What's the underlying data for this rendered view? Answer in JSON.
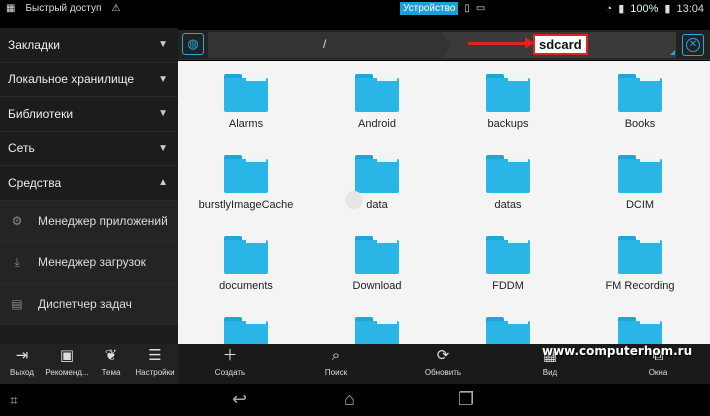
{
  "status_bar": {
    "left_label": "Быстрый доступ",
    "device_label": "Устройство",
    "battery": "100%",
    "time": "13:04"
  },
  "sidebar": {
    "sections": [
      {
        "label": "Закладки",
        "chevron": "chevron-down"
      },
      {
        "label": "Локальное хранилище",
        "chevron": "chevron-down"
      },
      {
        "label": "Библиотеки",
        "chevron": "chevron-down"
      },
      {
        "label": "Сеть",
        "chevron": "chevron-down"
      },
      {
        "label": "Средства",
        "chevron": "chevron-up"
      }
    ],
    "tools": [
      {
        "label": "Менеджер приложений",
        "icon": "gears-icon"
      },
      {
        "label": "Менеджер загрузок",
        "icon": "download-icon"
      },
      {
        "label": "Диспетчер задач",
        "icon": "task-manager-icon"
      }
    ]
  },
  "path_bar": {
    "root": "/",
    "current": "sdcard"
  },
  "folders": [
    {
      "name": "Alarms"
    },
    {
      "name": "Android"
    },
    {
      "name": "backups"
    },
    {
      "name": "Books"
    },
    {
      "name": "burstlyImageCache"
    },
    {
      "name": "data"
    },
    {
      "name": "datas"
    },
    {
      "name": "DCIM"
    },
    {
      "name": "documents"
    },
    {
      "name": "Download"
    },
    {
      "name": "FDDM"
    },
    {
      "name": "FM Recording"
    }
  ],
  "toolbar": {
    "left": [
      {
        "label": "Выход",
        "icon": "exit-icon"
      },
      {
        "label": "Рекоменд...",
        "icon": "gift-icon"
      },
      {
        "label": "Тема",
        "icon": "theme-icon"
      },
      {
        "label": "Настройки",
        "icon": "settings-icon"
      }
    ],
    "right": [
      {
        "label": "Создать",
        "icon": "plus-icon"
      },
      {
        "label": "Поиск",
        "icon": "search-icon"
      },
      {
        "label": "Обновить",
        "icon": "refresh-icon"
      },
      {
        "label": "Вид",
        "icon": "grid-icon"
      },
      {
        "label": "Окна",
        "icon": "windows-icon"
      }
    ],
    "watermark": "www.computerhom.ru"
  },
  "colors": {
    "accent": "#2aa6e0",
    "folder": "#29b6e6",
    "highlight": "#e0231f"
  }
}
